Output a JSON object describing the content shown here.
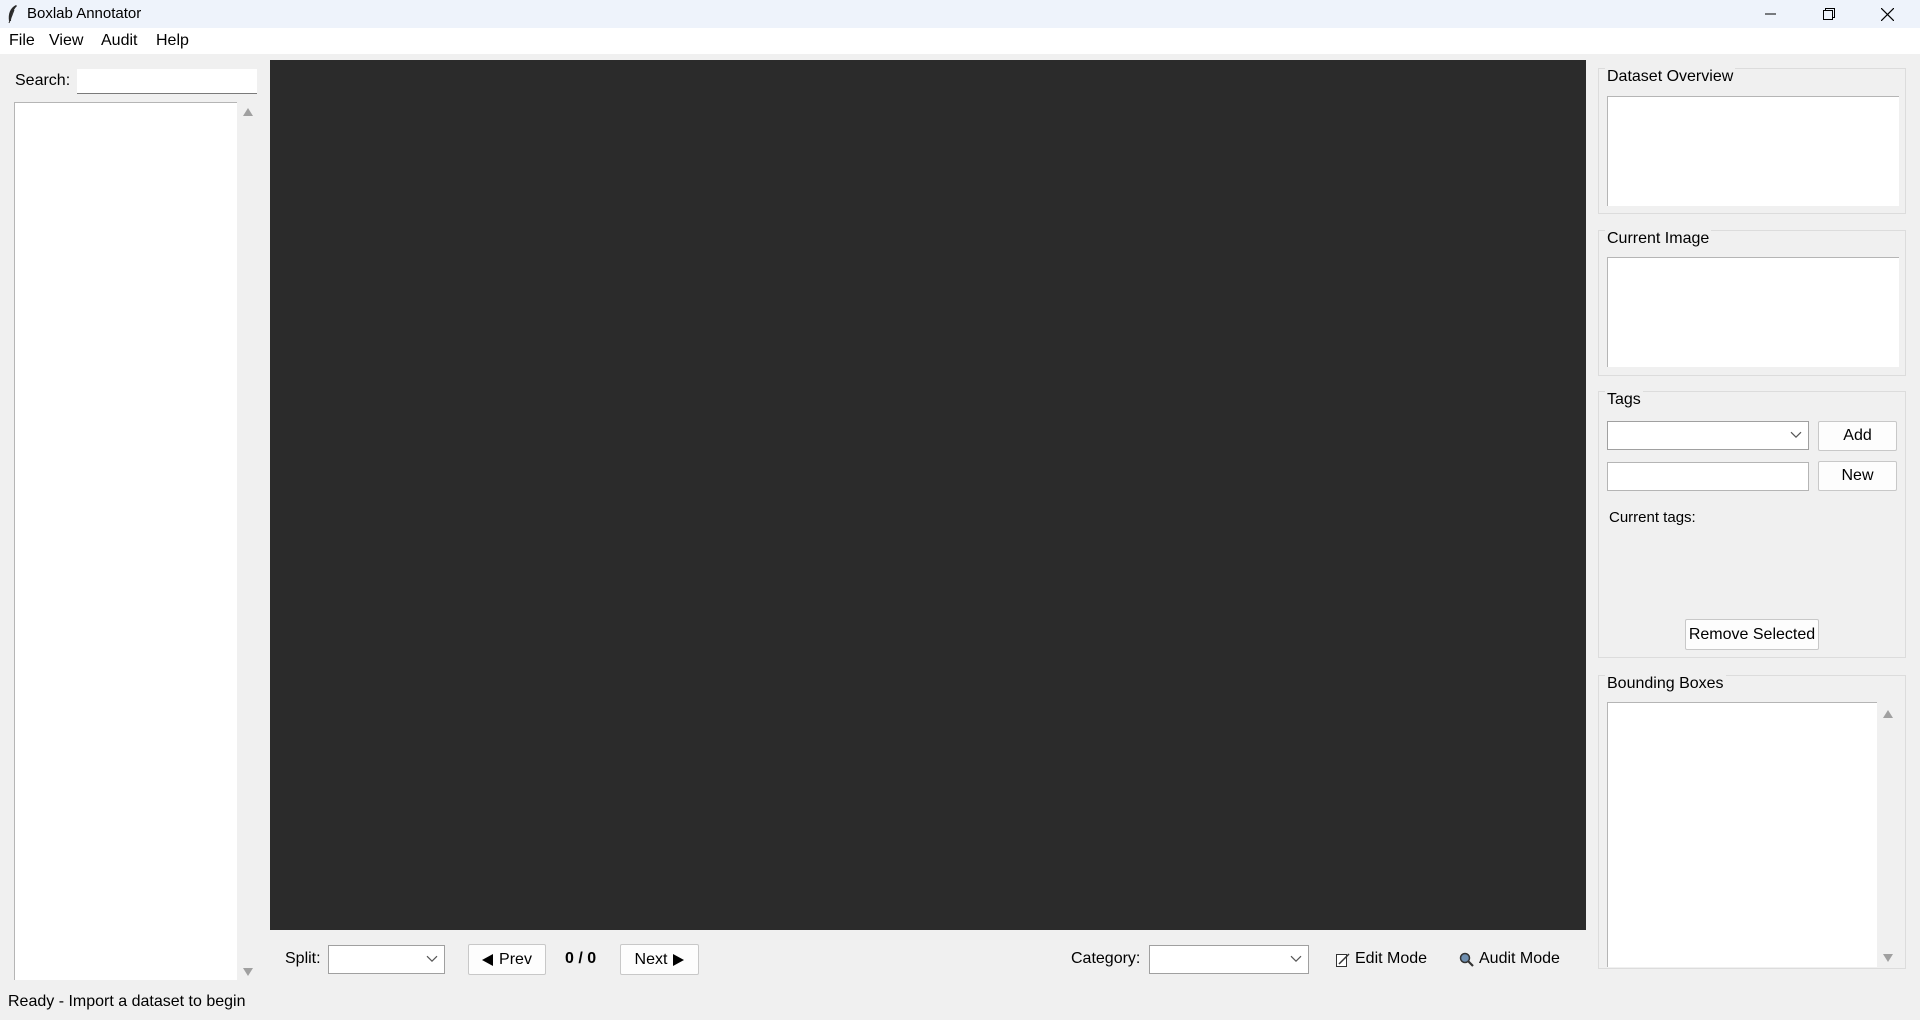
{
  "window": {
    "title": "Boxlab Annotator",
    "icon": "feather-icon",
    "controls": [
      "minimize-icon",
      "restore-icon",
      "close-icon"
    ]
  },
  "menu": {
    "items": [
      "File",
      "View",
      "Audit",
      "Help"
    ]
  },
  "left_panel": {
    "search_label": "Search:",
    "search_value": ""
  },
  "nav_bar": {
    "split_label": "Split:",
    "split_value": "",
    "prev_label": "Prev",
    "counter": "0 / 0",
    "next_label": "Next",
    "category_label": "Category:",
    "category_value": "",
    "edit_mode_label": "Edit Mode",
    "audit_mode_label": "Audit Mode"
  },
  "right_panel": {
    "dataset_overview_title": "Dataset Overview",
    "current_image_title": "Current Image",
    "tags_title": "Tags",
    "add_label": "Add",
    "new_label": "New",
    "current_tags_label": "Current tags:",
    "remove_selected_label": "Remove Selected",
    "bounding_boxes_title": "Bounding Boxes"
  },
  "status": {
    "text": "Ready - Import a dataset to begin"
  },
  "colors": {
    "canvas_bg": "#2b2b2b",
    "window_bg": "#f0f0f0",
    "titlebar_bg": "#eef3fb"
  }
}
